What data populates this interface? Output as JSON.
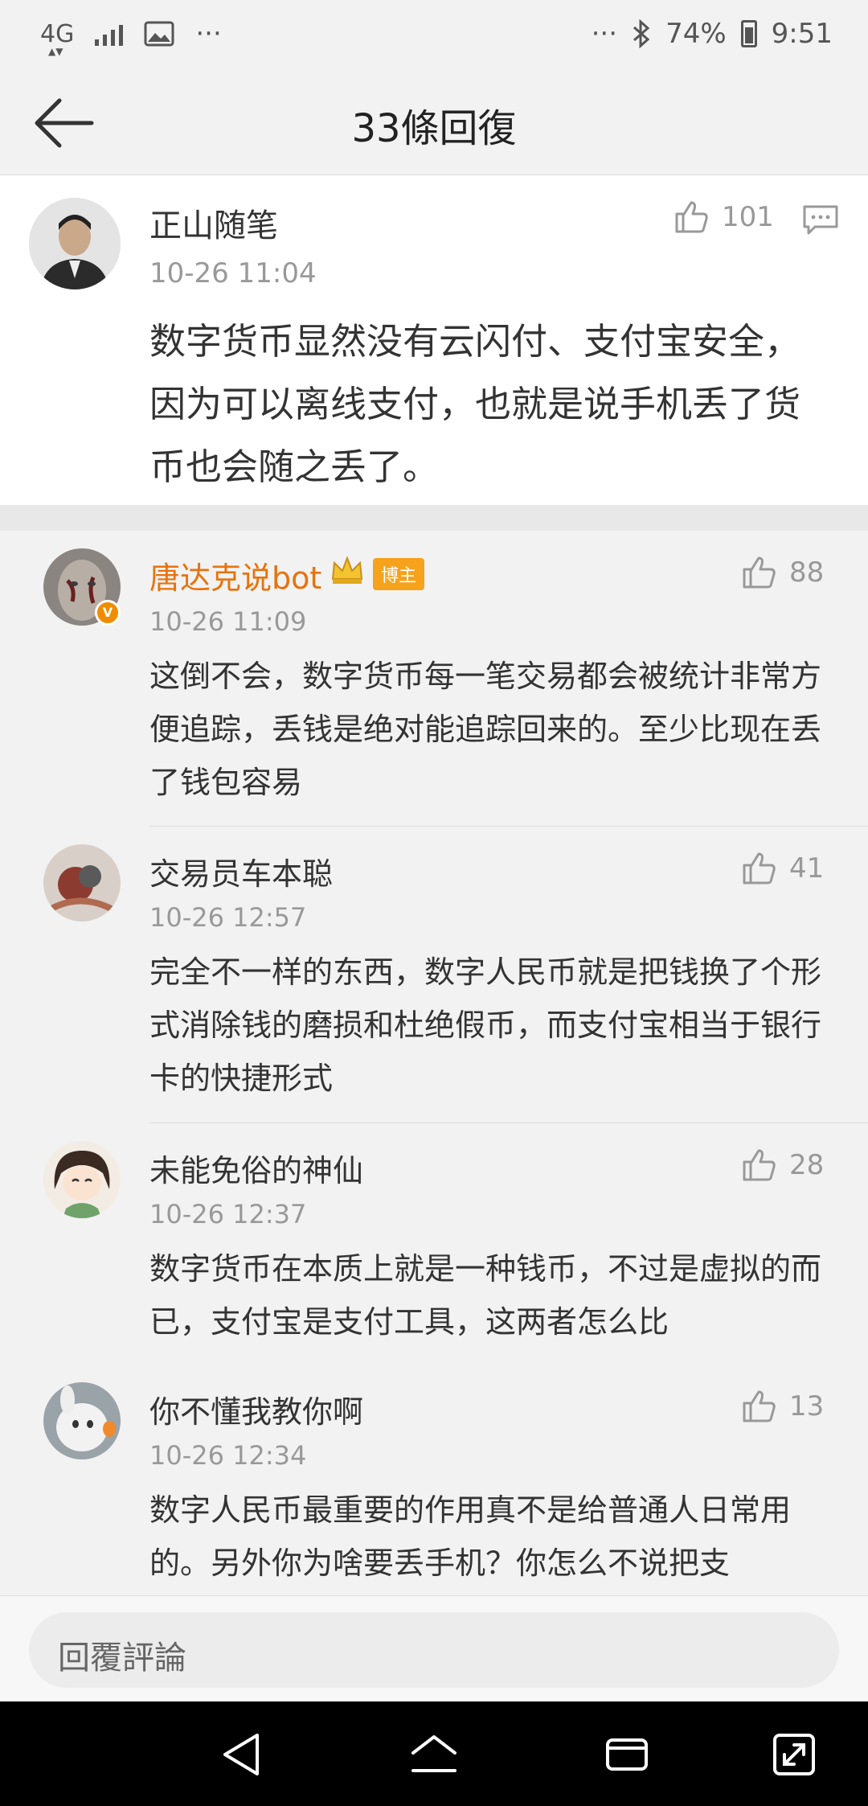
{
  "status": {
    "network": "4G",
    "more": "···",
    "more_right": "···",
    "battery": "74%",
    "time": "9:51"
  },
  "header": {
    "title": "33條回復"
  },
  "main_comment": {
    "author": "正山随笔",
    "time": "10-26 11:04",
    "likes": "101",
    "text": "数字货币显然没有云闪付、支付宝安全，因为可以离线支付，也就是说手机丢了货币也会随之丢了。"
  },
  "replies": [
    {
      "author": "唐达克说bot",
      "badge": "博主",
      "time": "10-26 11:09",
      "likes": "88",
      "text": "这倒不会，数字货币每一笔交易都会被统计非常方便追踪，丢钱是绝对能追踪回来的。至少比现在丢了钱包容易"
    },
    {
      "author": "交易员车本聪",
      "time": "10-26 12:57",
      "likes": "41",
      "text": "完全不一样的东西，数字人民币就是把钱换了个形式消除钱的磨损和杜绝假币，而支付宝相当于银行卡的快捷形式"
    },
    {
      "author": "未能免俗的神仙",
      "time": "10-26 12:37",
      "likes": "28",
      "text": "数字货币在本质上就是一种钱币，不过是虚拟的而已，支付宝是支付工具，这两者怎么比"
    },
    {
      "author": "你不懂我教你啊",
      "time": "10-26 12:34",
      "likes": "13",
      "text": "数字人民币最重要的作用真不是给普通人日常用的。另外你为啥要丢手机？你怎么不说把支"
    }
  ],
  "input": {
    "placeholder": "回覆評論"
  },
  "colors": {
    "vip_name": "#e8720c",
    "badge": "#f7a21b"
  }
}
